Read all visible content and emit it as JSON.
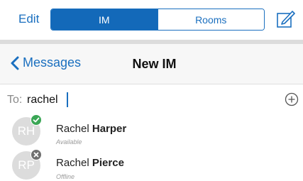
{
  "top_bar": {
    "edit_label": "Edit",
    "segments": [
      {
        "label": "IM",
        "active": true
      },
      {
        "label": "Rooms",
        "active": false
      }
    ],
    "compose_icon": "compose-icon"
  },
  "nav": {
    "back_label": "Messages",
    "title": "New IM"
  },
  "to_field": {
    "label": "To:",
    "value": "rachel"
  },
  "results": [
    {
      "initials": "RH",
      "first": "Rachel",
      "last": "Harper",
      "status": "Available",
      "presence": "available",
      "presence_color": "#3aa655"
    },
    {
      "initials": "RP",
      "first": "Rachel",
      "last": "Pierce",
      "status": "Offline",
      "presence": "offline",
      "presence_color": "#707070"
    }
  ],
  "colors": {
    "accent": "#1a6fbf",
    "segment_active": "#1369b9"
  }
}
